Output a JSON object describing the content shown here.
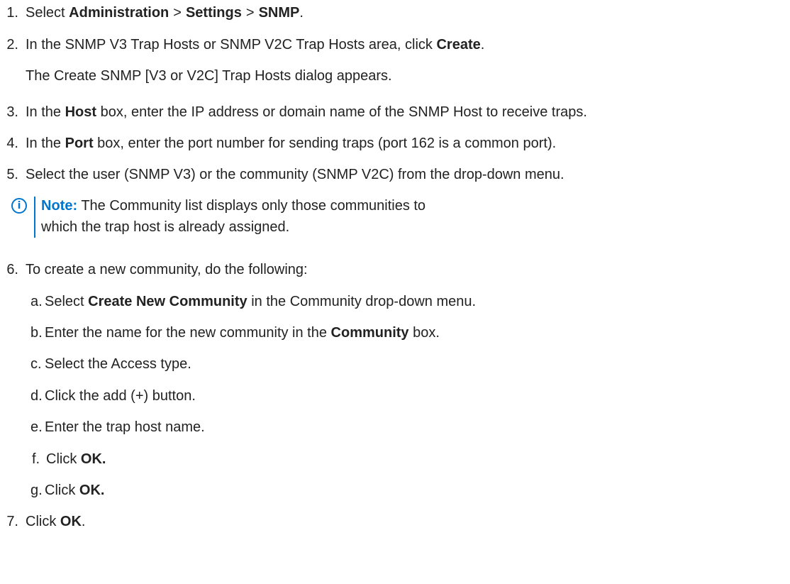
{
  "steps": {
    "s1": {
      "num": "1.",
      "pre": "Select",
      "part1": "Administration",
      "sep1": ">",
      "part2": "Settings",
      "sep2": ">",
      "part3": "SNMP",
      "post": "."
    },
    "s2": {
      "num": "2.",
      "pre": "In the SNMP V3 Trap Hosts or SNMP V2C Trap Hosts area, click",
      "bold": "Create",
      "post": ".",
      "result": "The Create SNMP [V3 or V2C] Trap Hosts dialog appears."
    },
    "s3": {
      "num": "3.",
      "pre": "In the",
      "bold": "Host",
      "post": "box, enter the IP address or domain name of the SNMP Host to receive traps."
    },
    "s4": {
      "num": "4.",
      "pre": "In the",
      "bold": "Port",
      "post": "box, enter the port number for sending traps (port 162 is a common port)."
    },
    "s5": {
      "num": "5.",
      "text": "Select the user (SNMP V3) or the community (SNMP V2C) from the drop-down menu."
    },
    "note": {
      "icon": "info-icon",
      "label": "Note:",
      "text": "The Community list displays only those communities to which the trap host is already assigned."
    },
    "s6": {
      "num": "6.",
      "text": "To create a new community, do the following:",
      "sub": {
        "a": {
          "letter": "a.",
          "pre": "Select",
          "bold": "Create New Community",
          "post": "in the Community drop-down menu."
        },
        "b": {
          "letter": "b.",
          "pre": "Enter the name for the new community in the",
          "bold": "Community",
          "post": "box."
        },
        "c": {
          "letter": "c.",
          "text": "Select the Access type."
        },
        "d": {
          "letter": "d.",
          "text": "Click the add (+) button."
        },
        "e": {
          "letter": "e.",
          "text": "Enter the trap host name."
        },
        "f": {
          "letter": "f.",
          "pre": "Click",
          "bold": "OK."
        },
        "g": {
          "letter": "g.",
          "pre": "Click",
          "bold": "OK."
        }
      }
    },
    "s7": {
      "num": "7.",
      "pre": "Click",
      "bold": "OK",
      "post": "."
    }
  }
}
